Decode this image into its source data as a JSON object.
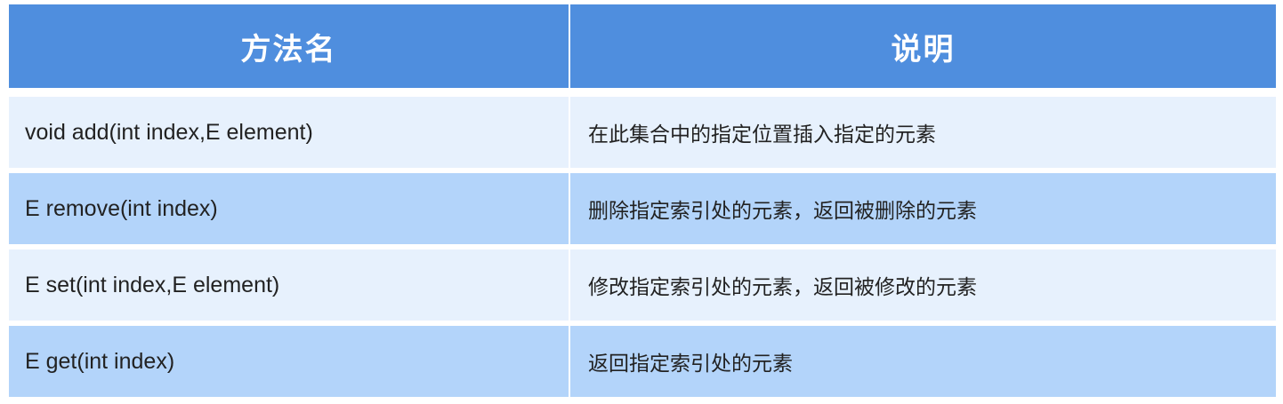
{
  "header": {
    "col1": "方法名",
    "col2": "说明"
  },
  "rows": [
    {
      "method": "void add(int index,E element)",
      "desc": "在此集合中的指定位置插入指定的元素"
    },
    {
      "method": "E remove(int index)",
      "desc": "删除指定索引处的元素，返回被删除的元素"
    },
    {
      "method": "E set(int index,E element)",
      "desc": "修改指定索引处的元素，返回被修改的元素"
    },
    {
      "method": "E get(int index)",
      "desc": "返回指定索引处的元素"
    }
  ],
  "colors": {
    "header_bg": "#4f8ede",
    "row_light": "#e7f1fd",
    "row_dark": "#b3d4fa"
  }
}
